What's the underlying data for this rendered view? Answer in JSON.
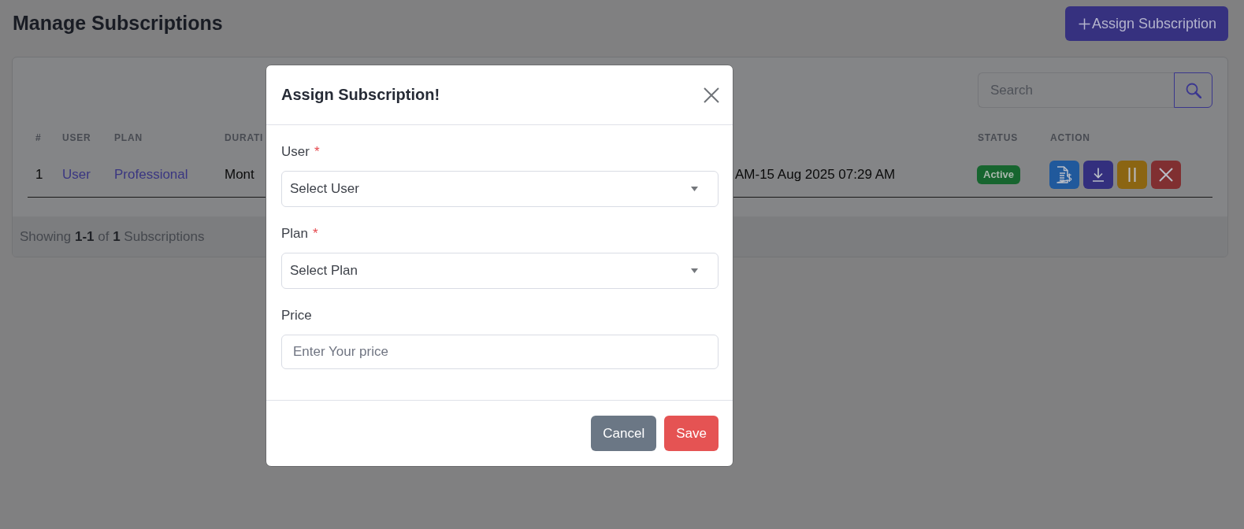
{
  "header": {
    "title": "Manage Subscriptions",
    "action_button": "Assign Subscription"
  },
  "search": {
    "placeholder": "Search"
  },
  "table": {
    "columns": [
      "#",
      "USER",
      "PLAN",
      "DURATI",
      "STATUS",
      "ACTION"
    ],
    "rows": [
      {
        "number": "1",
        "user": "User",
        "plan": "Professional",
        "duration": "Mont",
        "column_5": "AM-15 Aug 2025 07:29 AM",
        "status": {
          "label": "Active",
          "kind": "active"
        },
        "actions": [
          {
            "kind": "invoice"
          },
          {
            "kind": "download"
          },
          {
            "kind": "pause"
          },
          {
            "kind": "delete"
          }
        ]
      }
    ]
  },
  "summary": "Showing **1-1** of **1** Subscriptions",
  "modal": {
    "title": "Assign Subscription!",
    "fields": [
      {
        "kind": "select",
        "label": "User",
        "required_mark": "*",
        "placeholder": "Select User"
      },
      {
        "kind": "select",
        "label": "Plan",
        "required_mark": "*",
        "placeholder": "Select Plan"
      },
      {
        "kind": "input",
        "label": "Price",
        "placeholder": "Enter Your price"
      }
    ],
    "buttons": [
      {
        "kind": "secondary",
        "label": "Cancel"
      },
      {
        "kind": "danger",
        "label": "Save"
      }
    ]
  }
}
